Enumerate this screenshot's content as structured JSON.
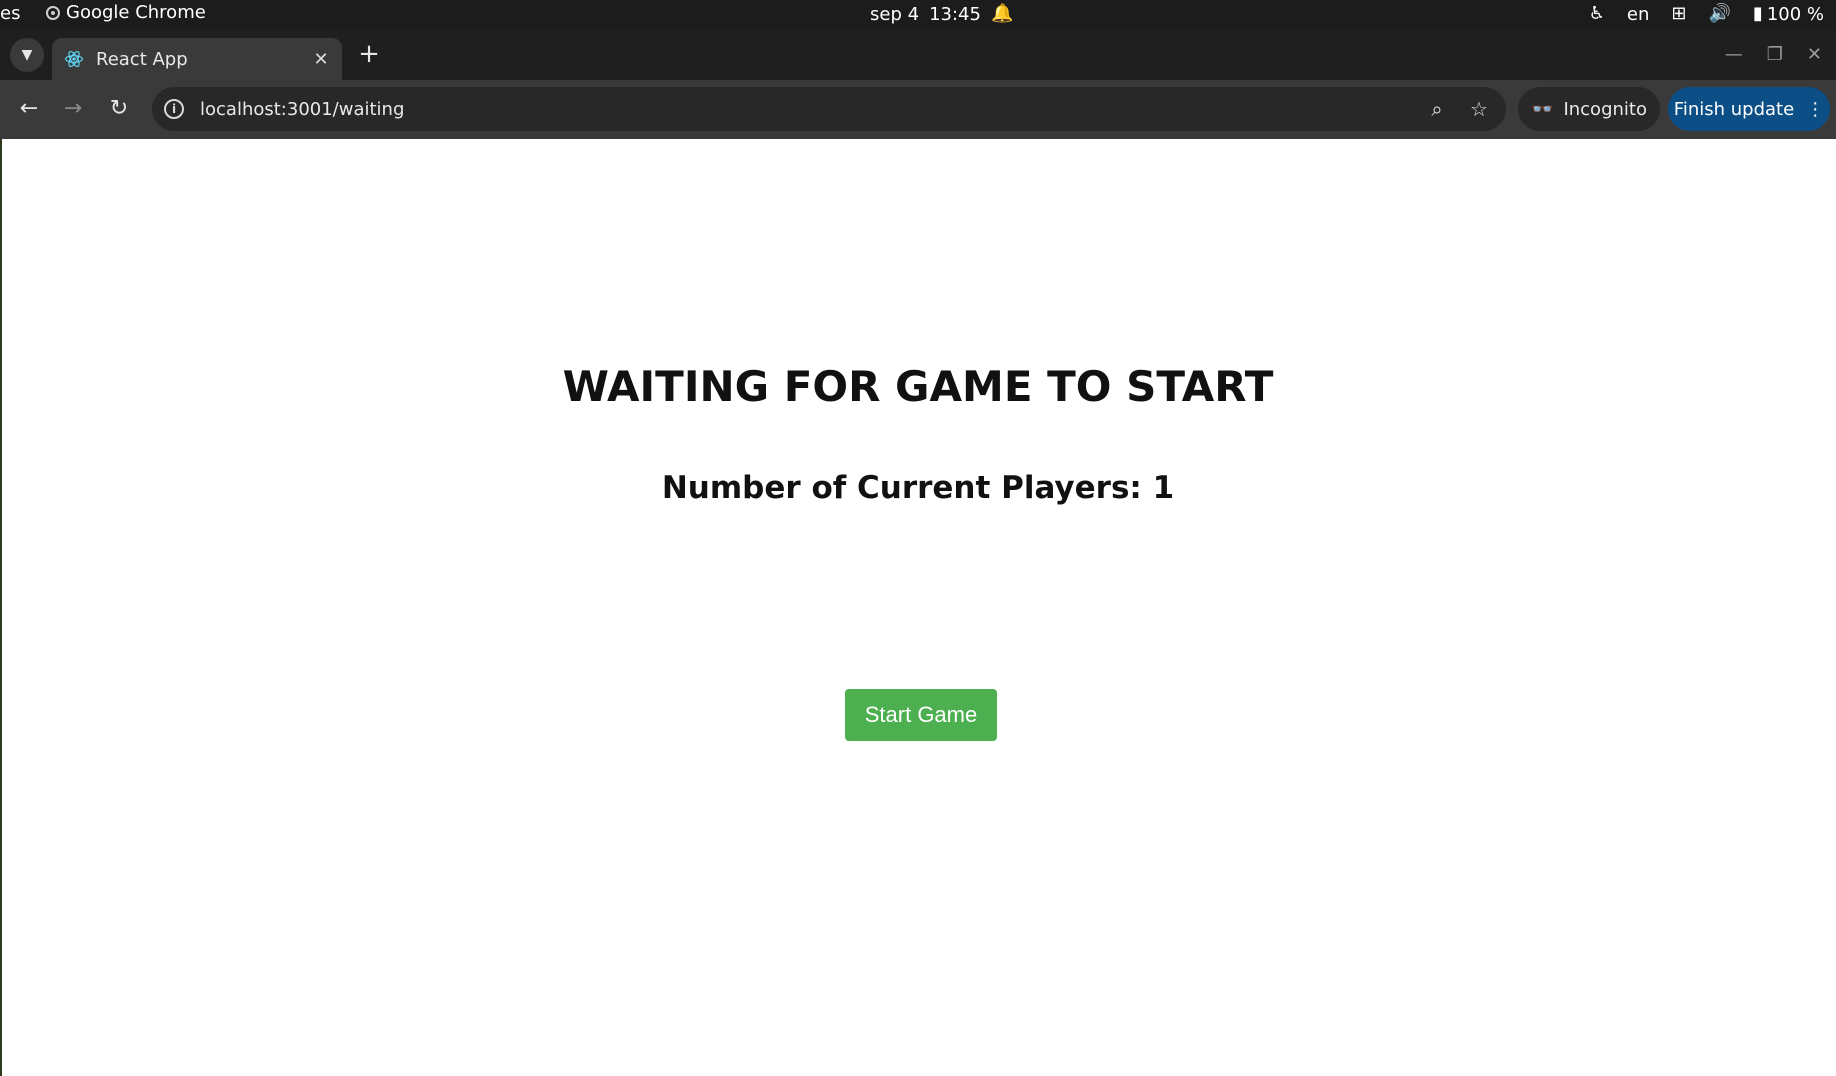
{
  "os_bar": {
    "activities": "es",
    "app_name": "Google Chrome",
    "date": "sep 4",
    "time": "13:45",
    "language": "en",
    "battery": "100 %"
  },
  "browser": {
    "tab_title": "React App",
    "url": "localhost:3001/waiting",
    "incognito_label": "Incognito",
    "update_label": "Finish update"
  },
  "page": {
    "title": "WAITING FOR GAME TO START",
    "players_label": "Number of Current Players: 1",
    "start_button": "Start Game"
  },
  "colors": {
    "start_button_bg": "#4caf50",
    "update_pill_bg": "#0b4f86"
  }
}
